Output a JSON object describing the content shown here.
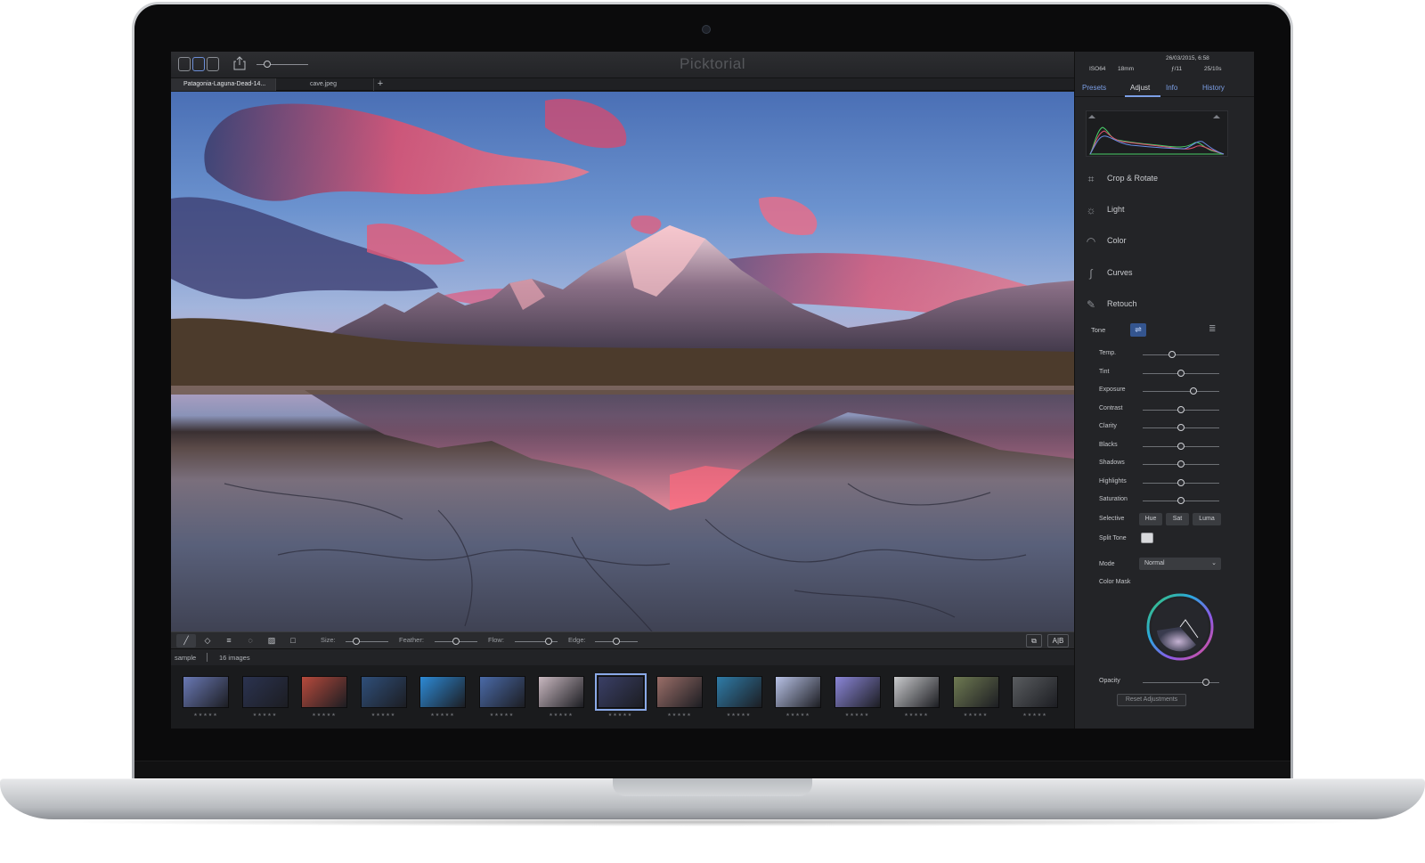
{
  "app": {
    "title": "Picktorial",
    "tabs": [
      {
        "label": "Patagonia-Laguna-Dead-14..."
      },
      {
        "label": "cave.jpeg"
      }
    ],
    "tab_add": "+"
  },
  "meta": {
    "date": "26/03/2015, 6:58",
    "iso": "ISO64",
    "focal": "18mm",
    "aperture": "ƒ/11",
    "shutter": "25/10s"
  },
  "panel": {
    "tabs": [
      {
        "label": "Presets"
      },
      {
        "label": "Adjust"
      },
      {
        "label": "Info"
      },
      {
        "label": "History"
      }
    ],
    "active_tab": "Adjust",
    "sections": [
      {
        "label": "Crop & Rotate",
        "icon": "crop-icon"
      },
      {
        "label": "Light",
        "icon": "bulb-icon"
      },
      {
        "label": "Color",
        "icon": "rainbow-icon"
      },
      {
        "label": "Curves",
        "icon": "curve-icon"
      },
      {
        "label": "Retouch",
        "icon": "brush-icon"
      }
    ],
    "tone_label": "Tone",
    "sliders": [
      {
        "label": "Temp.",
        "value": 0.38
      },
      {
        "label": "Tint",
        "value": 0.5
      },
      {
        "label": "Exposure",
        "value": 0.66
      },
      {
        "label": "Contrast",
        "value": 0.5
      },
      {
        "label": "Clarity",
        "value": 0.5
      },
      {
        "label": "Blacks",
        "value": 0.5
      },
      {
        "label": "Shadows",
        "value": 0.5
      },
      {
        "label": "Highlights",
        "value": 0.5
      },
      {
        "label": "Saturation",
        "value": 0.5
      }
    ],
    "selective_label": "Selective",
    "selective_buttons": [
      "Hue",
      "Sat",
      "Luma"
    ],
    "split_tone_label": "Split Tone",
    "mode_label": "Mode",
    "mode_value": "Normal",
    "color_mask_label": "Color Mask",
    "opacity_label": "Opacity",
    "opacity_value": 0.82,
    "reset_label": "Reset Adjustments"
  },
  "brush": {
    "size_label": "Size:",
    "feather_label": "Feather:",
    "flow_label": "Flow:",
    "edge_label": "Edge:",
    "size_value": 0.25,
    "feather_value": 0.5,
    "flow_value": 0.8,
    "edge_value": 0.5,
    "ab_label": "A|B"
  },
  "library": {
    "name": "sample",
    "count": "16 images",
    "rating": "★★★★★",
    "thumb_colors": [
      "#6a79b5",
      "#2b3350",
      "#b74a3c",
      "#2f4f7a",
      "#2d8ad6",
      "#4a6aa8",
      "#c9b8c0",
      "#3a3f66",
      "#9a6e68",
      "#2f7ca8",
      "#b8c2e6",
      "#8b86d8",
      "#c9cacc",
      "#6f7a52",
      "#5a5d60"
    ],
    "selected_index": 7
  }
}
